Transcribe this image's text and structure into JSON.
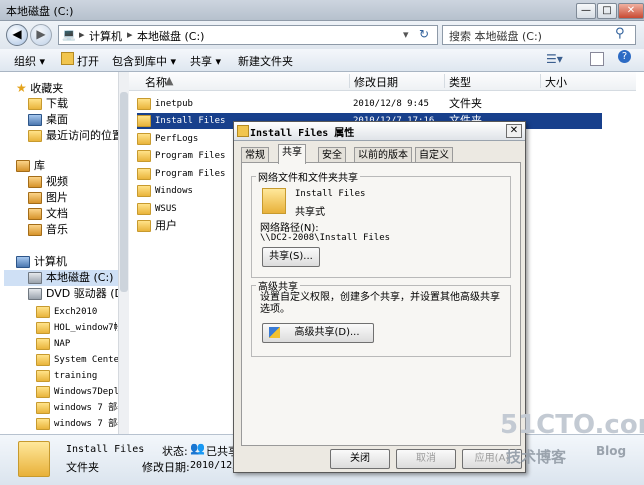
{
  "window": {
    "title": "本地磁盘 (C:)",
    "min": "—",
    "max": "□",
    "close": "✕"
  },
  "address": {
    "crumbs": [
      "计算机",
      "本地磁盘 (C:)"
    ],
    "sep": "▸",
    "search_placeholder": "搜索 本地磁盘 (C:)"
  },
  "toolbar": {
    "organize": "组织 ▾",
    "open": "打开",
    "include": "包含到库中 ▾",
    "share": "共享 ▾",
    "newfolder": "新建文件夹"
  },
  "nav": {
    "favorites": "收藏夹",
    "downloads": "下载",
    "desktop": "桌面",
    "recent": "最近访问的位置",
    "libraries": "库",
    "videos": "视频",
    "pictures": "图片",
    "documents": "文档",
    "music": "音乐",
    "computer": "计算机",
    "localdisk": "本地磁盘 (C:)",
    "dvd": "DVD 驱动器 (D:)",
    "sub": [
      "Exch2010",
      "HOL_window7帐",
      "NAP",
      "System Center",
      "training",
      "Windows7Deploy",
      "windows 7 部署",
      "windows 7 部署"
    ]
  },
  "columns": {
    "name": "名称",
    "modified": "修改日期",
    "type": "类型",
    "size": "大小"
  },
  "files": [
    {
      "name": "inetpub",
      "date": "2010/12/8 9:45",
      "type": "文件夹"
    },
    {
      "name": "Install Files",
      "date": "2010/12/7 17:16",
      "type": "文件夹"
    },
    {
      "name": "PerfLogs",
      "date": "",
      "type": ""
    },
    {
      "name": "Program Files",
      "date": "",
      "type": ""
    },
    {
      "name": "Program Files",
      "date": "",
      "type": ""
    },
    {
      "name": "Windows",
      "date": "",
      "type": ""
    },
    {
      "name": "WSUS",
      "date": "",
      "type": ""
    },
    {
      "name": "用户",
      "date": "",
      "type": ""
    }
  ],
  "details": {
    "name": "Install Files",
    "kind": "文件夹",
    "state_label": "状态:",
    "state_value": "已共享",
    "date_label": "修改日期:",
    "date_value": "2010/12/7"
  },
  "dialog": {
    "title": "Install Files 属性",
    "close": "✕",
    "tabs": [
      "常规",
      "共享",
      "安全",
      "以前的版本",
      "自定义"
    ],
    "share_group": "网络文件和文件夹共享",
    "folder_name": "Install Files",
    "folder_state": "共享式",
    "path_label": "网络路径(N):",
    "path": "\\\\DC2-2008\\Install Files",
    "share_btn": "共享(S)...",
    "adv_group": "高级共享",
    "adv_desc": "设置自定义权限，创建多个共享，并设置其他高级共享选项。",
    "adv_btn": "高级共享(D)...",
    "ok": "关闭",
    "cancel": "取消",
    "apply": "应用(A)"
  },
  "watermark": {
    "site": "51CTO.com",
    "cn": "技术博客",
    "blog": "Blog"
  }
}
